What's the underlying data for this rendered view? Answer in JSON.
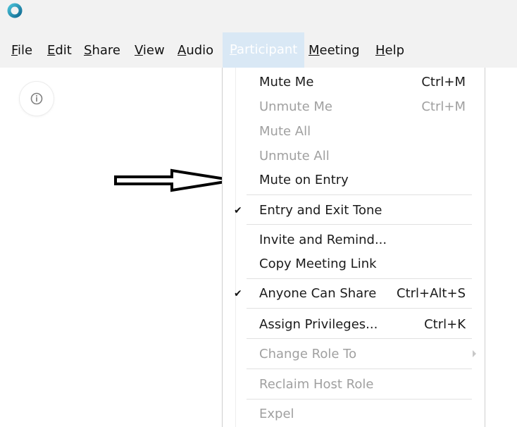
{
  "menubar": {
    "items": [
      {
        "label": "File",
        "mnemonic_index": 0
      },
      {
        "label": "Edit",
        "mnemonic_index": 0
      },
      {
        "label": "Share",
        "mnemonic_index": 0
      },
      {
        "label": "View",
        "mnemonic_index": 0
      },
      {
        "label": "Audio",
        "mnemonic_index": 0
      },
      {
        "label": "Participant",
        "mnemonic_index": 0,
        "active": true
      },
      {
        "label": "Meeting",
        "mnemonic_index": 0
      },
      {
        "label": "Help",
        "mnemonic_index": 0
      }
    ]
  },
  "dropdown": {
    "items": [
      {
        "label": "Mute Me",
        "shortcut": "Ctrl+M",
        "enabled": true,
        "checked": false
      },
      {
        "label": "Unmute Me",
        "shortcut": "Ctrl+M",
        "enabled": false,
        "checked": false
      },
      {
        "label": "Mute All",
        "shortcut": "",
        "enabled": false,
        "checked": false
      },
      {
        "label": "Unmute All",
        "shortcut": "",
        "enabled": false,
        "checked": false
      },
      {
        "label": "Mute on Entry",
        "shortcut": "",
        "enabled": true,
        "checked": false
      },
      {
        "label": "Entry and Exit Tone",
        "shortcut": "",
        "enabled": true,
        "checked": true
      },
      {
        "label": "Invite and Remind...",
        "shortcut": "",
        "enabled": true,
        "checked": false
      },
      {
        "label": "Copy Meeting Link",
        "shortcut": "",
        "enabled": true,
        "checked": false
      },
      {
        "label": "Anyone Can Share",
        "shortcut": "Ctrl+Alt+S",
        "enabled": true,
        "checked": true
      },
      {
        "label": "Assign Privileges...",
        "shortcut": "Ctrl+K",
        "enabled": true,
        "checked": false
      },
      {
        "label": "Change Role To",
        "shortcut": "",
        "enabled": false,
        "checked": false,
        "submenu": true
      },
      {
        "label": "Reclaim Host Role",
        "shortcut": "",
        "enabled": false,
        "checked": false
      },
      {
        "label": "Expel",
        "shortcut": "",
        "enabled": false,
        "checked": false
      }
    ]
  },
  "icons": {
    "app": "app-logo-icon",
    "info": "info-icon",
    "checkmark": "checkmark-icon",
    "submenu": "submenu-arrow-icon",
    "annotation": "annotation-arrow-icon"
  },
  "colors": {
    "menu_active_bg": "#d9e8f5",
    "menu_active_text": "#ffffff",
    "disabled_text": "#a0a0a0"
  }
}
